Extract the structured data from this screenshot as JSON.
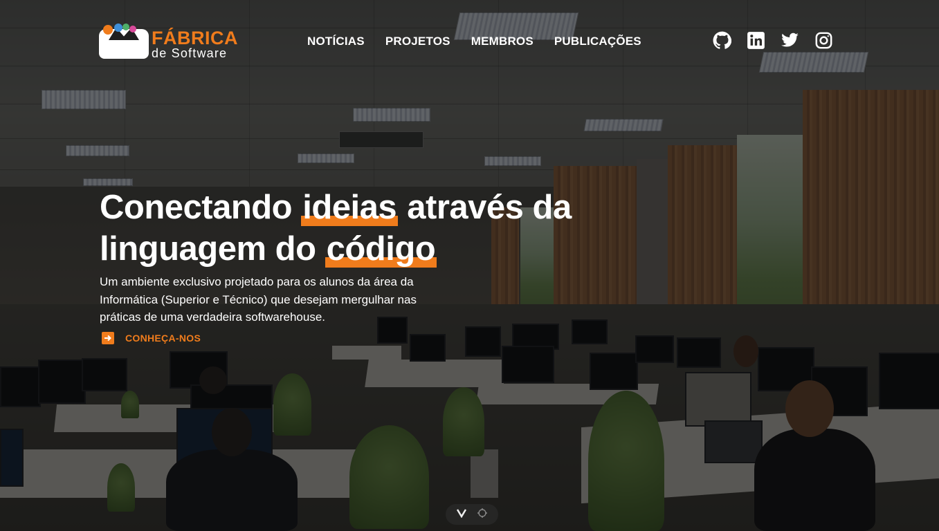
{
  "brand": {
    "name_top": "FÁBRICA",
    "name_bottom": "de Software",
    "colors": {
      "accent": "#f07c1c",
      "dot_orange": "#f07c1c",
      "dot_blue": "#3f8fd8",
      "dot_green": "#4fb06a",
      "dot_pink": "#d84a9a"
    }
  },
  "nav": {
    "items": [
      {
        "label": "NOTÍCIAS"
      },
      {
        "label": "PROJETOS"
      },
      {
        "label": "MEMBROS"
      },
      {
        "label": "PUBLICAÇÕES"
      }
    ]
  },
  "social": {
    "icons": [
      "github-icon",
      "linkedin-icon",
      "twitter-icon",
      "instagram-icon"
    ]
  },
  "hero": {
    "title_part1": "Conectando ",
    "title_highlight1": "ideias",
    "title_part2": " através da linguagem do ",
    "title_highlight2": "código",
    "description": "Um ambiente exclusivo projetado para os alunos da área da Informática (Superior e Técnico) que desejam mergulhar nas práticas de uma verdadeira softwarehouse.",
    "cta_label": "CONHEÇA-NOS",
    "cta_icon": "arrow-right-icon"
  },
  "scroll_indicator": {
    "icons": [
      "chevron-down-icon",
      "crosshair-icon"
    ]
  }
}
